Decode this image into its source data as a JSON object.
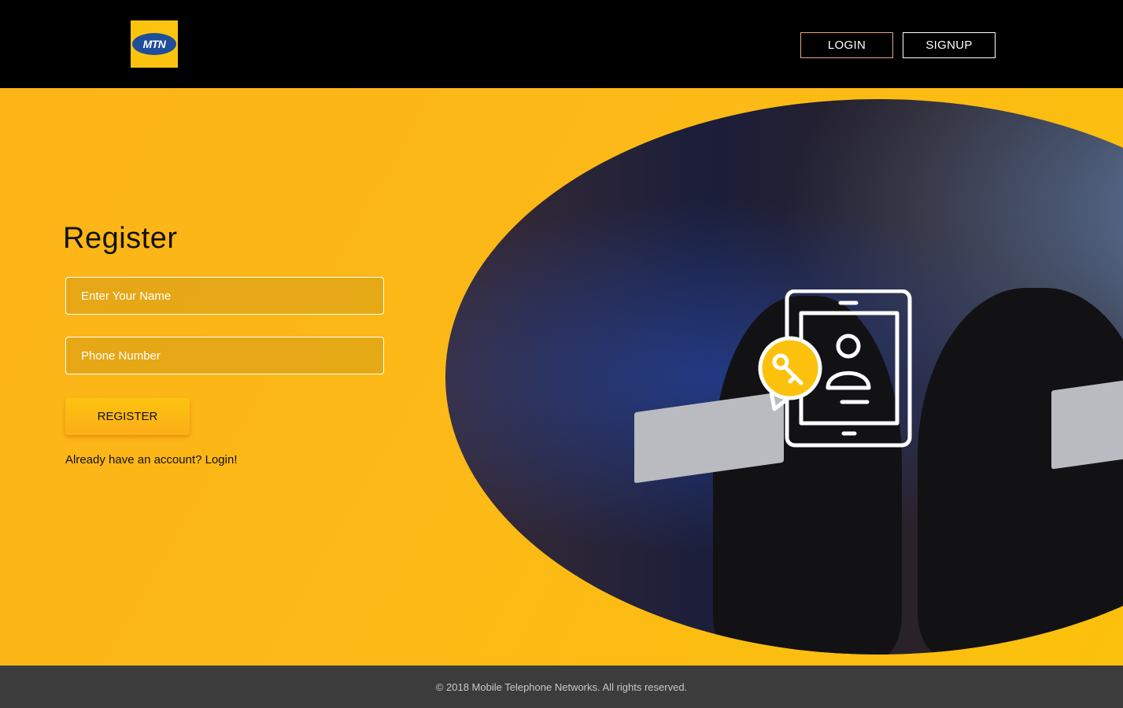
{
  "header": {
    "logo_text": "MTN",
    "nav": {
      "login": "LOGIN",
      "signup": "SIGNUP"
    }
  },
  "form": {
    "title": "Register",
    "name_placeholder": "Enter Your Name",
    "phone_placeholder": "Phone Number",
    "submit": "REGISTER",
    "login_prompt": "Already have an account? Login!"
  },
  "footer": {
    "copyright": "© 2018 Mobile Telephone Networks. All rights reserved."
  },
  "colors": {
    "brand_yellow": "#fcc40e",
    "header_bg": "#000000",
    "footer_bg": "#3c3c3c",
    "logo_blue": "#1f4e9a"
  },
  "icons": [
    "mtn-logo",
    "tablet-account-security-icon"
  ]
}
